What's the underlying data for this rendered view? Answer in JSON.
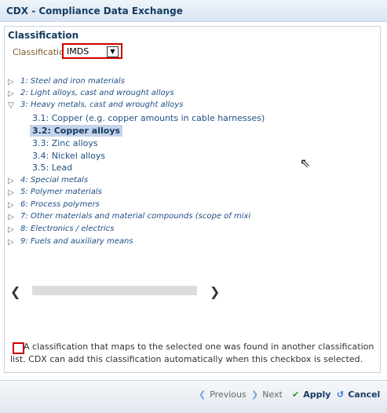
{
  "window": {
    "title": "CDX - Compliance Data Exchange"
  },
  "panel": {
    "title": "Classification"
  },
  "classification": {
    "label": "Classification",
    "value": "IMDS"
  },
  "tree": {
    "items": [
      "1: Steel and iron materials",
      "2: Light alloys, cast and wrought alloys",
      "3: Heavy metals, cast and wrought alloys",
      "4: Special metals",
      "5: Polymer materials",
      "6: Process polymers",
      "7: Other materials and material compounds (scope of mixi",
      "8: Electronics / electrics",
      "9: Fuels and auxiliary means"
    ],
    "subitems": [
      "3.1: Copper (e.g. copper amounts in cable harnesses)",
      "3.2: Copper alloys",
      "3.3: Zinc alloys",
      "3.4: Nickel alloys",
      "3.5: Lead"
    ]
  },
  "note": {
    "text": "A classification that maps to the selected one was found in another classification list. CDX can add this classification automatically when this checkbox is selected."
  },
  "buttons": {
    "previous": "Previous",
    "next": "Next",
    "apply": "Apply",
    "cancel": "Cancel"
  }
}
